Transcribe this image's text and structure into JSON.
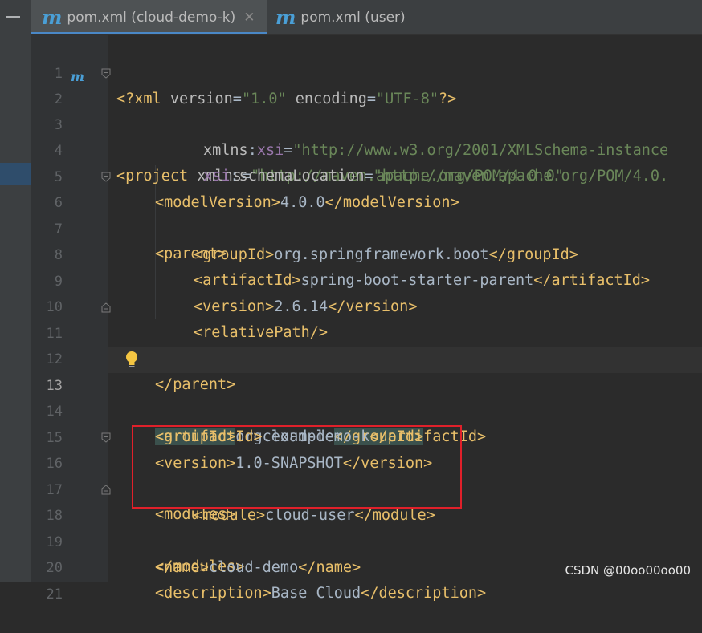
{
  "tabs": [
    {
      "icon": "m",
      "label": "pom.xml (cloud-demo-k)",
      "close": "✕",
      "active": true
    },
    {
      "icon": "m",
      "label": "pom.xml (user)",
      "close": "",
      "active": false
    }
  ],
  "gutter_icon": "m",
  "lines": [
    {
      "n": "1"
    },
    {
      "n": "2"
    },
    {
      "n": "3"
    },
    {
      "n": "4"
    },
    {
      "n": "5"
    },
    {
      "n": "6"
    },
    {
      "n": "7"
    },
    {
      "n": "8"
    },
    {
      "n": "9"
    },
    {
      "n": "10"
    },
    {
      "n": "11"
    },
    {
      "n": "12"
    },
    {
      "n": "13"
    },
    {
      "n": "14"
    },
    {
      "n": "15"
    },
    {
      "n": "16"
    },
    {
      "n": "17"
    },
    {
      "n": "18"
    },
    {
      "n": "19"
    },
    {
      "n": "20"
    },
    {
      "n": "21"
    }
  ],
  "code": {
    "l1": {
      "open": "<?xml ",
      "a1": "version",
      "eq1": "=",
      "v1": "\"1.0\"",
      "a2": " encoding",
      "eq2": "=",
      "v2": "\"UTF-8\"",
      "close": "?>"
    },
    "l2": {
      "tag": "<project ",
      "a": "xmlns",
      "eq": "=",
      "v": "\"http://maven.apache.org/POM/4.0.0\""
    },
    "l3": {
      "a": "xmlns",
      "colon": ":",
      "ns": "xsi",
      "eq": "=",
      "v": "\"http://www.w3.org/2001/XMLSchema-instance"
    },
    "l4": {
      "ns": "xsi",
      "colon": ":",
      "a": "schemaLocation",
      "eq": "=",
      "v": "\"http://maven.apache.org/POM/4.0."
    },
    "l5": {
      "open": "<modelVersion>",
      "text": "4.0.0",
      "close": "</modelVersion>"
    },
    "l6": {
      "open": "<parent>"
    },
    "l7": {
      "open": "<groupId>",
      "text": "org.springframework.boot",
      "close": "</groupId>"
    },
    "l8": {
      "open": "<artifactId>",
      "text": "spring-boot-starter-parent",
      "close": "</artifactId>"
    },
    "l9": {
      "open": "<version>",
      "text": "2.6.14",
      "close": "</version>"
    },
    "l10": {
      "open": "<relativePath/>"
    },
    "l11": {
      "open": "</parent>"
    },
    "l13": {
      "open": "<groupId>",
      "text": "org.example",
      "close": "</groupId>"
    },
    "l14": {
      "open": "<artifactId>",
      "text": "cloud-demo-k",
      "close": "</artifactId>"
    },
    "l15": {
      "open": "<version>",
      "text": "1.0-SNAPSHOT",
      "close": "</version>"
    },
    "l16": {
      "open": "<modules>"
    },
    "l17": {
      "open": "<module>",
      "text": "cloud-user",
      "close": "</module>"
    },
    "l18": {
      "open": "</modules>"
    },
    "l19": {
      "open": "<name>",
      "text": "cloud-demo",
      "close": "</name>"
    },
    "l20": {
      "open": "<description>",
      "text": "Base Cloud",
      "close": "</description>"
    }
  },
  "watermark": "CSDN @00oo00oo00",
  "colors": {
    "tag": "#e8bf6a",
    "string": "#6a8759",
    "namespace": "#9876aa",
    "text": "#a9b7c6",
    "highlight_box": "#e0202a",
    "tab_accent": "#4a88c7"
  }
}
